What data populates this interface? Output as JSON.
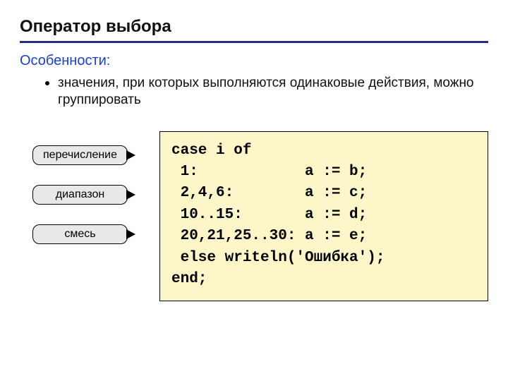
{
  "title": "Оператор выбора",
  "subhead": "Особенности:",
  "bullet": "значения, при которых выполняются одинаковые действия, можно группировать",
  "labels": {
    "enum": "перечисление",
    "range": "диапазон",
    "mix": "смесь"
  },
  "code": "case i of\n 1:            a := b;\n 2,4,6:        a := c;\n 10..15:       a := d;\n 20,21,25..30: a := e;\n else writeln('Ошибка');\nend;"
}
